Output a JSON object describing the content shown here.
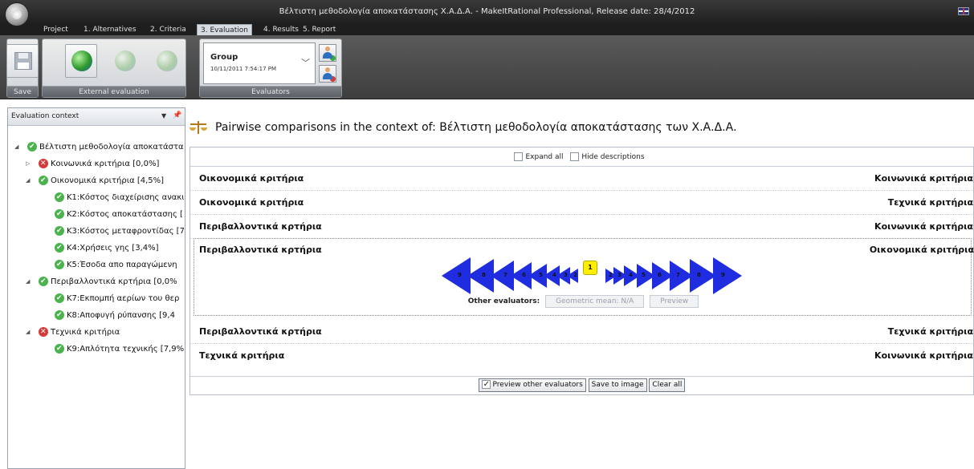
{
  "window": {
    "title": "Βέλτιστη μεθοδολογία αποκατάστασης Χ.Α.Δ.Α. - MakeItRational Professional, Release date: 28/4/2012"
  },
  "menu": {
    "tabs": [
      {
        "label": "Project"
      },
      {
        "label": "1. Alternatives"
      },
      {
        "label": "2. Criteria"
      },
      {
        "label": "3. Evaluation",
        "active": true
      },
      {
        "label": "4. Results"
      },
      {
        "label": "5. Report"
      }
    ]
  },
  "ribbon": {
    "save_label": "Save",
    "external_evaluation_label": "External evaluation",
    "evaluators_label": "Evaluators",
    "evaluator_select": {
      "title": "Group",
      "date": "10/11/2011 7:54:17 PM"
    }
  },
  "left_panel": {
    "title": "Evaluation context",
    "tree": [
      {
        "label": "Βέλτιστη μεθοδολογία αποκατάστα",
        "status": "ok",
        "level": 0,
        "expand": "open"
      },
      {
        "label": "Κοινωνικά κριτήρια [0,0%]",
        "status": "bad",
        "level": 1,
        "expand": "closed"
      },
      {
        "label": "Οικονομικά κριτήρια [4,5%]",
        "status": "ok",
        "level": 1,
        "expand": "open"
      },
      {
        "label": "Κ1:Κόστος διαχείρισης ανακυ",
        "status": "ok",
        "level": 2,
        "expand": "none"
      },
      {
        "label": "Κ2:Κόστος αποκατάστασης [",
        "status": "ok",
        "level": 2,
        "expand": "none"
      },
      {
        "label": "Κ3:Κόστος μεταφροντίδας [7",
        "status": "ok",
        "level": 2,
        "expand": "none"
      },
      {
        "label": "Κ4:Χρήσεις γης [3,4%]",
        "status": "ok",
        "level": 2,
        "expand": "none"
      },
      {
        "label": "Κ5:Έσοδα απο παραγώμενη",
        "status": "ok",
        "level": 2,
        "expand": "none"
      },
      {
        "label": "Περιβαλλοντικά κρτήρια [0,0%",
        "status": "ok",
        "level": 1,
        "expand": "open"
      },
      {
        "label": "Κ7:Εκπομπή αερίων του θερ",
        "status": "ok",
        "level": 2,
        "expand": "none"
      },
      {
        "label": "Κ8:Αποφυγή ρύπανσης [9,4",
        "status": "ok",
        "level": 2,
        "expand": "none"
      },
      {
        "label": "Τεχνικά κριτήρια",
        "status": "bad",
        "level": 1,
        "expand": "open"
      },
      {
        "label": "Κ9:Απλότητα τεχνικής [7,9%",
        "status": "ok",
        "level": 2,
        "expand": "none"
      }
    ]
  },
  "main": {
    "title": "Pairwise comparisons in the context of: Βέλτιστη μεθοδολογία αποκατάστασης των Χ.Α.Δ.Α.",
    "expand_all_label": "Expand all",
    "hide_descriptions_label": "Hide descriptions",
    "pairs": [
      {
        "left": "Οικονομικά κριτήρια",
        "right": "Κοινωνικά κριτήρια"
      },
      {
        "left": "Οικονομικά κριτήρια",
        "right": "Τεχνικά κριτήρια"
      },
      {
        "left": "Περιβαλλοντικά κρτήρια",
        "right": "Κοινωνικά κριτήρια"
      },
      {
        "left": "Περιβαλλοντικά κρτήρια",
        "right": "Οικονομικά κριτήρια"
      },
      {
        "left": "Περιβαλλοντικά κρτήρια",
        "right": "Τεχνικά κριτήρια"
      },
      {
        "left": "Τεχνικά κριτήρια",
        "right": "Κοινωνικά κριτήρια"
      }
    ],
    "scale": {
      "left_values": [
        "9",
        "8",
        "7",
        "6",
        "5",
        "4",
        "3",
        "2"
      ],
      "selected_value": "1",
      "right_values": [
        "2",
        "3",
        "4",
        "5",
        "6",
        "7",
        "8",
        "9"
      ]
    },
    "other_evaluators_label": "Other evaluators:",
    "geometric_mean_label": "Geometric mean: N/A",
    "preview_label": "Preview",
    "preview_other_evaluators_label": "Preview other evaluators",
    "preview_other_evaluators_checked": true,
    "save_to_image_label": "Save to image",
    "clear_all_label": "Clear all",
    "accent_color": "#1f2ce0"
  }
}
